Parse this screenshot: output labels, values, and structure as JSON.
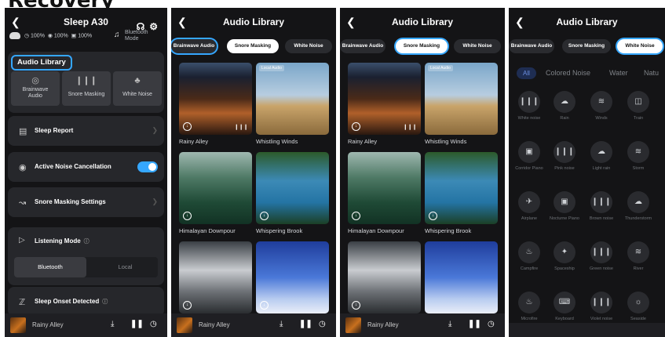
{
  "headline": "Recovery",
  "panel1": {
    "back_icon": "chevron-left-icon",
    "title": "Sleep A30",
    "battery": {
      "left": "100%",
      "right": "100%",
      "case": "100%"
    },
    "mode": "Bluetooth Mode",
    "audio_library": {
      "title": "Audio Library",
      "buttons": [
        {
          "label": "Brainwave Audio",
          "icon": "target-icon"
        },
        {
          "label": "Snore Masking",
          "icon": "waveform-icon"
        },
        {
          "label": "White Noise",
          "icon": "cluster-icon"
        }
      ]
    },
    "rows": [
      {
        "label": "Sleep Report",
        "icon": "report-icon"
      },
      {
        "label": "Active Noise Cancellation",
        "icon": "anc-icon",
        "toggle": "on"
      },
      {
        "label": "Snore Masking Settings",
        "icon": "snore-icon"
      }
    ],
    "listening_mode": {
      "label": "Listening Mode",
      "options": [
        "Bluetooth",
        "Local"
      ],
      "selected": "Bluetooth"
    },
    "sleep_onset": "Sleep Onset Detected"
  },
  "player": {
    "track": "Rainy Alley"
  },
  "library": {
    "title": "Audio Library",
    "tabs": [
      "Brainwave Audio",
      "Snore Masking",
      "White Noise"
    ],
    "badge": "Local Audio",
    "tracks": [
      "Rainy Alley",
      "Whistling Winds",
      "Himalayan Downpour",
      "Whispering Brook"
    ]
  },
  "panel4": {
    "categories": [
      "All",
      "Colored Noise",
      "Water",
      "Natu"
    ],
    "sounds": [
      "White noise",
      "Rain",
      "Winds",
      "Train",
      "Corridor Piano",
      "Pink noise",
      "Light rain",
      "Storm",
      "Airplane",
      "Nocturne Piano",
      "Brown noise",
      "Thunderstorm",
      "Campfire",
      "Spaceship",
      "Green noise",
      "River",
      "Microfire",
      "Keyboard",
      "Violet noise",
      "Seaside"
    ]
  },
  "colors": {
    "accent": "#35a7ff",
    "panel_bg": "#141416",
    "card_bg": "#26272b"
  }
}
